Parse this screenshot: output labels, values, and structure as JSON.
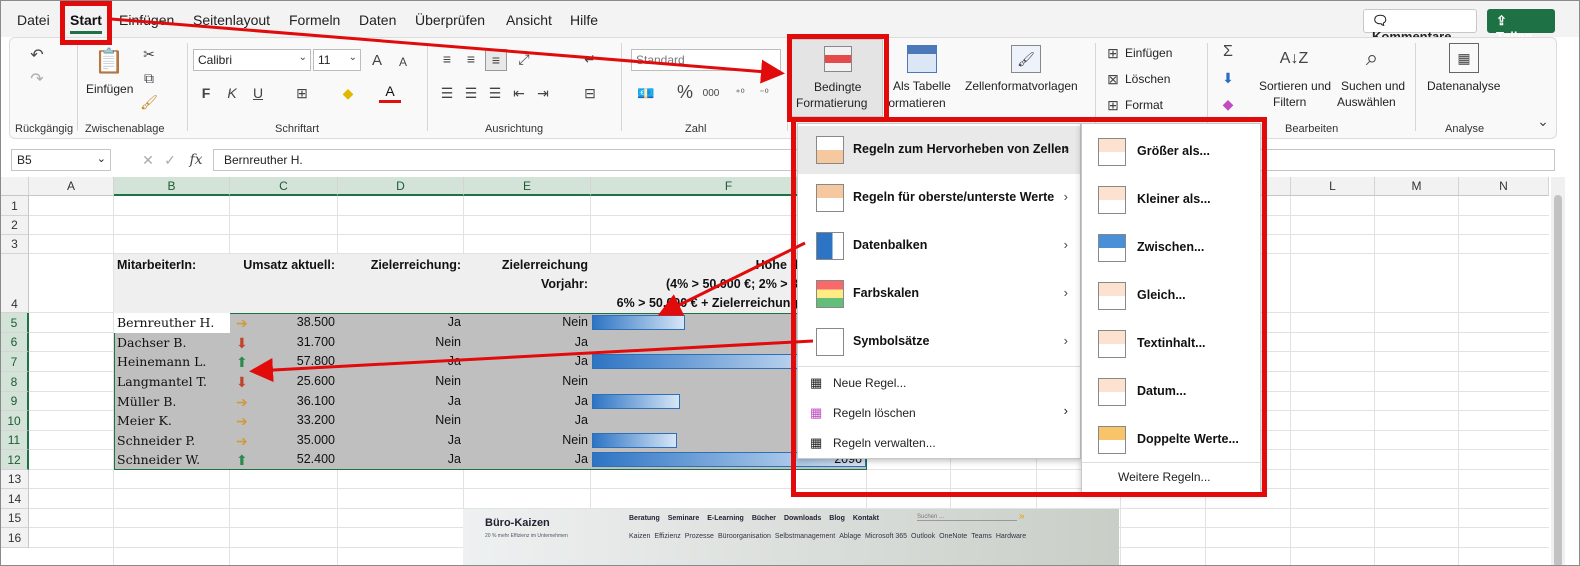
{
  "menubar": {
    "tabs": [
      "Datei",
      "Start",
      "Einfügen",
      "Seitenlayout",
      "Formeln",
      "Daten",
      "Überprüfen",
      "Ansicht",
      "Hilfe"
    ],
    "active": "Start",
    "comments_label": "Kommentare",
    "share_label": "Teilen"
  },
  "ribbon": {
    "groups": {
      "undo": "Rückgängig",
      "clipboard": "Zwischenablage",
      "font": "Schriftart",
      "alignment": "Ausrichtung",
      "number": "Zahl",
      "edit": "Bearbeiten",
      "analysis": "Analyse"
    },
    "paste_label": "Einfügen",
    "font_name": "Calibri",
    "font_size": "11",
    "number_format": "Standard",
    "cond_format_line1": "Bedingte",
    "cond_format_line2": "Formatierung",
    "as_table_line1": "Als Tabelle",
    "as_table_line2": "formatieren",
    "cell_styles": "Zellenformatvorlagen",
    "insert": "Einfügen",
    "delete": "Löschen",
    "format": "Format",
    "sort_line1": "Sortieren und",
    "sort_line2": "Filtern",
    "find_line1": "Suchen und",
    "find_line2": "Auswählen",
    "data_analysis": "Datenanalyse",
    "bold": "F",
    "italic": "K",
    "underline": "U",
    "percent": "%",
    "thousands": "000"
  },
  "formula_bar": {
    "name_box": "B5",
    "fx": "fx",
    "content": "Bernreuther H."
  },
  "columns": [
    "A",
    "B",
    "C",
    "D",
    "E",
    "F",
    "L",
    "M",
    "N"
  ],
  "rows": [
    "1",
    "2",
    "3",
    "4",
    "5",
    "6",
    "7",
    "8",
    "9",
    "10",
    "11",
    "12",
    "13",
    "14",
    "15",
    "16"
  ],
  "table": {
    "headers": {
      "employee": "MitarbeiterIn:",
      "revenue": "Umsatz aktuell:",
      "target": "Zielerreichung:",
      "prev_line1": "Zielerreichung",
      "prev_line2": "Vorjahr:",
      "f_line1": "Höhe d",
      "f_line2": "(4% > 50.000 €; 2% > 3",
      "f_line3": "6% > 50.000 € + Zielerreichung"
    },
    "rows": [
      {
        "name": "Bernreuther H.",
        "trend": "side",
        "revenue": "38.500",
        "target": "Ja",
        "prev": "Nein",
        "bar": 0.34
      },
      {
        "name": "Dachser B.",
        "trend": "down",
        "revenue": "31.700",
        "target": "Nein",
        "prev": "Ja",
        "bar": 0
      },
      {
        "name": "Heinemann L.",
        "trend": "up",
        "revenue": "57.800",
        "target": "Ja",
        "prev": "Ja",
        "bar": 0.9
      },
      {
        "name": "Langmantel T.",
        "trend": "down",
        "revenue": "25.600",
        "target": "Nein",
        "prev": "Nein",
        "bar": 0
      },
      {
        "name": "Müller B.",
        "trend": "side",
        "revenue": "36.100",
        "target": "Ja",
        "prev": "Ja",
        "bar": 0.32
      },
      {
        "name": "Meier K.",
        "trend": "side",
        "revenue": "33.200",
        "target": "Nein",
        "prev": "Ja",
        "bar": 0
      },
      {
        "name": "Schneider P.",
        "trend": "side",
        "revenue": "35.000",
        "target": "Ja",
        "prev": "Nein",
        "bar": 0.31
      },
      {
        "name": "Schneider W.",
        "trend": "up",
        "revenue": "52.400",
        "target": "Ja",
        "prev": "Ja",
        "bar": 1.0
      }
    ],
    "last_value": "2096"
  },
  "menu": {
    "items": [
      {
        "label": "Regeln zum Hervorheben von Zellen",
        "arrow": true
      },
      {
        "label": "Regeln für oberste/unterste Werte",
        "arrow": true
      },
      {
        "label": "Datenbalken",
        "arrow": true
      },
      {
        "label": "Farbskalen",
        "arrow": true
      },
      {
        "label": "Symbolsätze",
        "arrow": true
      }
    ],
    "plain": [
      {
        "label": "Neue Regel..."
      },
      {
        "label": "Regeln löschen",
        "arrow": true
      },
      {
        "label": "Regeln verwalten..."
      }
    ]
  },
  "submenu": {
    "items": [
      "Größer als...",
      "Kleiner als...",
      "Zwischen...",
      "Gleich...",
      "Textinhalt...",
      "Datum...",
      "Doppelte Werte..."
    ],
    "more": "Weitere Regeln..."
  },
  "banner": {
    "brand": "Büro-Kaizen",
    "brand_sub": "20 % mehr Effizienz im Unternehmen",
    "nav": [
      "Beratung",
      "Seminare",
      "E-Learning",
      "Bücher",
      "Downloads",
      "Blog",
      "Kontakt"
    ],
    "search_placeholder": "Suchen ...",
    "tags": [
      "Kaizen",
      "Effizienz",
      "Prozesse",
      "Büroorganisation",
      "Selbstmanagement",
      "Ablage",
      "Microsoft 365",
      "Outlook",
      "OneNote",
      "Teams",
      "Hardware"
    ]
  },
  "colors": {
    "accent": "#1e7145",
    "highlight": "#e20b0b",
    "bar": "#2d74c4"
  }
}
